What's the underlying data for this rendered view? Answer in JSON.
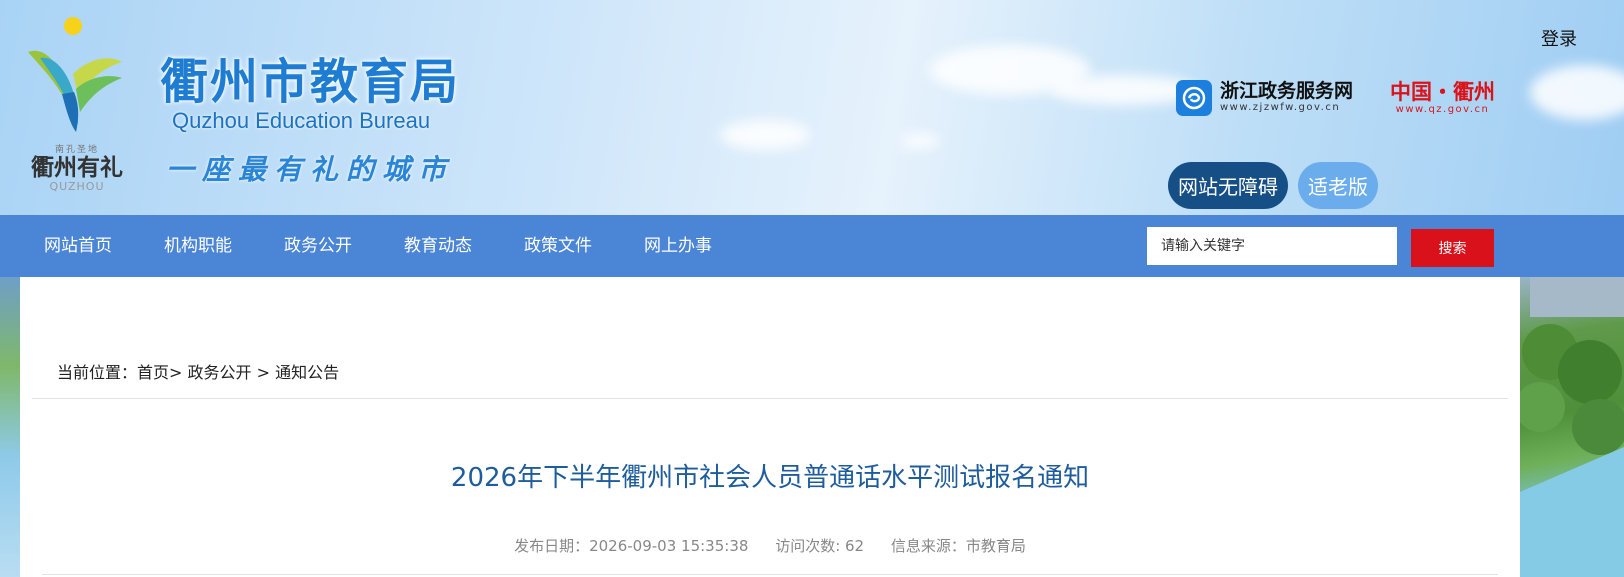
{
  "header": {
    "site_title_cn": "衢州市教育局",
    "site_title_en": "Quzhou Education Bureau",
    "motto": "一座最有礼的城市",
    "slogan_small": "南孔圣地",
    "slogan_main": "衢州有礼",
    "slogan_en": "QUZHOU",
    "login_label": "登录",
    "zj_portal": {
      "name": "浙江政务服务网",
      "url": "www.zjzwfw.gov.cn"
    },
    "qz_portal": {
      "name": "中国・衢州",
      "url": "www.qz.gov.cn"
    },
    "accessible_label": "网站无障碍",
    "elder_label": "适老版"
  },
  "nav": {
    "items": [
      "网站首页",
      "机构职能",
      "政务公开",
      "教育动态",
      "政策文件",
      "网上办事"
    ],
    "search_placeholder": "请输入关键字",
    "search_label": "搜索"
  },
  "breadcrumb": {
    "prefix": "当前位置：",
    "home": "首页",
    "sep1": "> ",
    "level1": "政务公开",
    "sep2": " > ",
    "level2": "通知公告"
  },
  "article": {
    "title": "2026年下半年衢州市社会人员普通话水平测试报名通知",
    "publish_date": "发布日期：2026-09-03 15:35:38",
    "visits": "访问次数: 62",
    "source": "信息来源：市教育局"
  },
  "colors": {
    "nav_bg": "#4b85d6",
    "search_button": "#d9111a",
    "title_blue": "#1f5c9c",
    "accessible_btn": "#164f86",
    "elder_btn": "#6aacec"
  }
}
